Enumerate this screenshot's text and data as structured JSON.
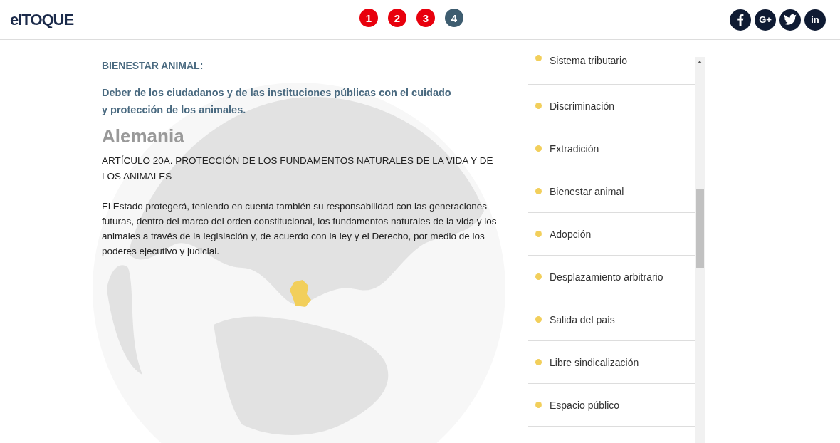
{
  "logo": "elTOQUE",
  "steps": [
    {
      "label": "1",
      "selected": false
    },
    {
      "label": "2",
      "selected": false
    },
    {
      "label": "3",
      "selected": false
    },
    {
      "label": "4",
      "selected": true
    }
  ],
  "social": [
    {
      "kind": "facebook"
    },
    {
      "kind": "googleplus",
      "label": "G+"
    },
    {
      "kind": "twitter"
    },
    {
      "kind": "linkedin",
      "label": "in"
    }
  ],
  "topic": {
    "heading": "BIENESTAR ANIMAL:",
    "description": "Deber de los ciudadanos y de las instituciones públicas con el cuidado y protección de los animales."
  },
  "country": "Alemania",
  "article": {
    "title": "ARTÍCULO 20A. PROTECCIÓN DE LOS FUNDAMENTOS NATURALES DE LA VIDA Y DE LOS ANIMALES",
    "body": "El Estado protegerá, teniendo en cuenta también su responsabilidad con las generaciones futuras, dentro del marco del orden constitucional, los fundamentos naturales de la vida y los animales a través de la legislación y, de acuerdo con la ley y el Derecho, por medio de los poderes ejecutivo y judicial."
  },
  "topics": [
    {
      "label": "Sistema tributario",
      "color": "#f2cf5b"
    },
    {
      "label": "Discriminación",
      "color": "#f2cf5b"
    },
    {
      "label": "Extradición",
      "color": "#f2cf5b"
    },
    {
      "label": "Bienestar animal",
      "color": "#f2cf5b"
    },
    {
      "label": "Adopción",
      "color": "#f2cf5b"
    },
    {
      "label": "Desplazamiento arbitrario",
      "color": "#f2cf5b"
    },
    {
      "label": "Salida del país",
      "color": "#f2cf5b"
    },
    {
      "label": "Libre sindicalización",
      "color": "#f2cf5b"
    },
    {
      "label": "Espacio público",
      "color": "#f2cf5b"
    }
  ]
}
